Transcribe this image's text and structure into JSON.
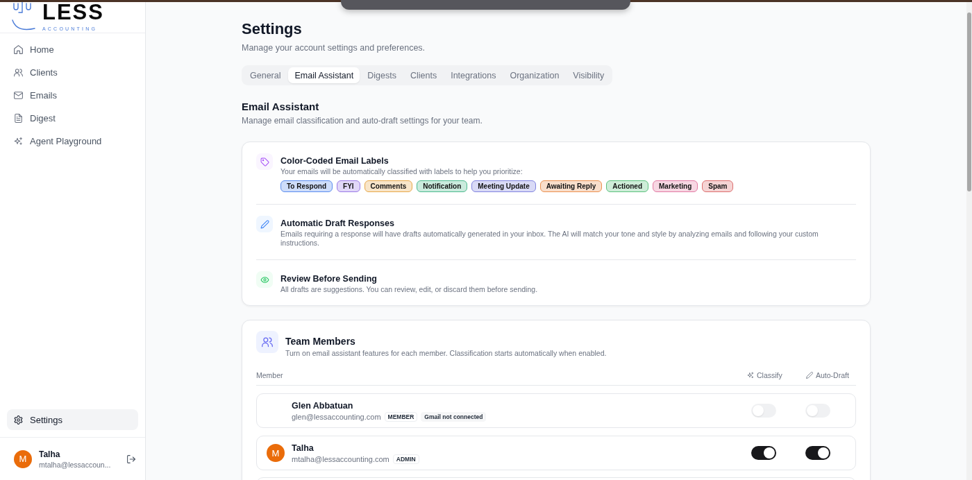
{
  "logo": {
    "wordmark": "LESS",
    "tagline": "ACCOUNTING"
  },
  "sidebar": {
    "items": [
      {
        "label": "Home",
        "selected": false
      },
      {
        "label": "Clients",
        "selected": false
      },
      {
        "label": "Emails",
        "selected": false
      },
      {
        "label": "Digest",
        "selected": false
      },
      {
        "label": "Agent Playground",
        "selected": false
      }
    ],
    "footer_items": [
      {
        "label": "Settings",
        "selected": true
      }
    ],
    "user": {
      "avatar": "M",
      "name": "Talha",
      "email": "mtalha@lessaccoun..."
    }
  },
  "page": {
    "title": "Settings",
    "subtitle": "Manage your account settings and preferences."
  },
  "tabs": [
    {
      "label": "General",
      "selected": false
    },
    {
      "label": "Email Assistant",
      "selected": true
    },
    {
      "label": "Digests",
      "selected": false
    },
    {
      "label": "Clients",
      "selected": false
    },
    {
      "label": "Integrations",
      "selected": false
    },
    {
      "label": "Organization",
      "selected": false
    },
    {
      "label": "Visibility",
      "selected": false
    }
  ],
  "section": {
    "title": "Email Assistant",
    "subtitle": "Manage email classification and auto-draft settings for your team."
  },
  "features": [
    {
      "kind": "labels",
      "title": "Color-Coded Email Labels",
      "description": "Your emails will be automatically classified with labels to help you prioritize:",
      "labels": [
        {
          "text": "To Respond",
          "color": "#5b8def"
        },
        {
          "text": "FYI",
          "color": "#9b7be6"
        },
        {
          "text": "Comments",
          "color": "#e8a94a"
        },
        {
          "text": "Notification",
          "color": "#4dbb8f"
        },
        {
          "text": "Meeting Update",
          "color": "#8184e0"
        },
        {
          "text": "Awaiting Reply",
          "color": "#ec9150"
        },
        {
          "text": "Actioned",
          "color": "#5cc27e"
        },
        {
          "text": "Marketing",
          "color": "#e37aa3"
        },
        {
          "text": "Spam",
          "color": "#dd6f6f"
        }
      ]
    },
    {
      "kind": "info",
      "title": "Automatic Draft Responses",
      "description": "Emails requiring a response will have drafts automatically generated in your inbox. The AI will match your tone and style by analyzing emails and following your custom instructions."
    },
    {
      "kind": "info",
      "title": "Review Before Sending",
      "description": "All drafts are suggestions. You can review, edit, or discard them before sending."
    }
  ],
  "team": {
    "title": "Team Members",
    "description": "Turn on email assistant features for each member. Classification starts automatically when enabled.",
    "columns": [
      {
        "label": "Member"
      },
      {
        "label": "Classify"
      },
      {
        "label": "Auto-Draft"
      }
    ],
    "members": [
      {
        "name": "Glen Abbatuan",
        "email": "glen@lessaccounting.com",
        "tags": [
          {
            "text": "MEMBER",
            "kind": "role"
          },
          {
            "text": "Gmail not connected",
            "kind": "status"
          }
        ],
        "toggles": [
          {
            "on": false,
            "disabled": true
          },
          {
            "on": false,
            "disabled": true
          }
        ]
      },
      {
        "avatar": "M",
        "name": "Talha",
        "email": "mtalha@lessaccounting.com",
        "tags": [
          {
            "text": "ADMIN",
            "kind": "role"
          }
        ],
        "toggles": [
          {
            "on": true,
            "disabled": false
          },
          {
            "on": true,
            "disabled": false
          }
        ]
      }
    ]
  }
}
